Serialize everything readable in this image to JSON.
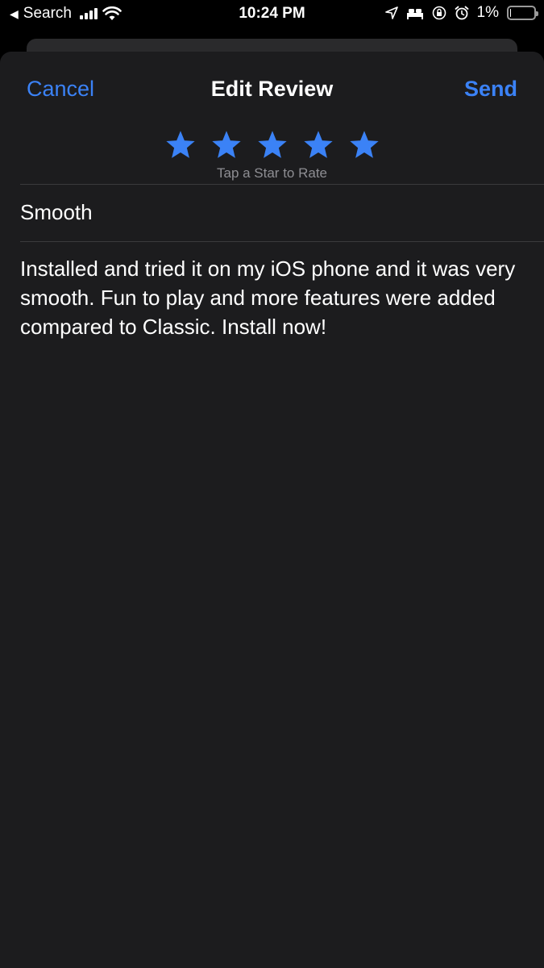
{
  "status_bar": {
    "back_label": "Search",
    "time": "10:24 PM",
    "battery": "1%",
    "battery_level": 0.01
  },
  "nav": {
    "cancel": "Cancel",
    "title": "Edit Review",
    "send": "Send"
  },
  "rating": {
    "stars": 5,
    "max": 5,
    "hint": "Tap a Star to Rate",
    "color": "#3b82f6"
  },
  "review": {
    "title": "Smooth",
    "body": "Installed and tried it on my iOS phone and it was very smooth. Fun to play and more features were added compared to Classic. Install now!"
  },
  "colors": {
    "accent": "#3b82f6",
    "sheet": "#1c1c1e"
  }
}
